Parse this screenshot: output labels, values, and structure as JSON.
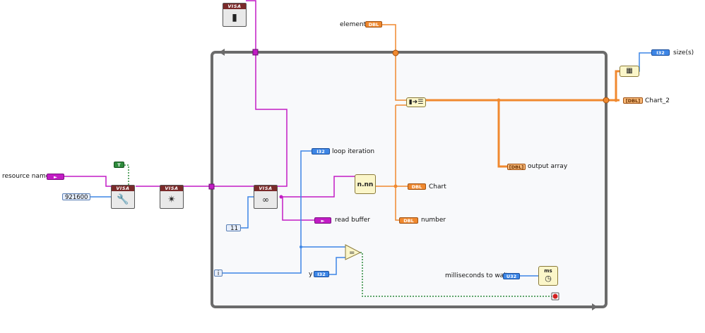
{
  "labels": {
    "resource_name": "resource name",
    "element": "element",
    "size": "size(s)",
    "chart2": "Chart_2",
    "loop_iteration": "loop iteration",
    "output_array": "output array",
    "chart": "Chart",
    "read_buffer": "read buffer",
    "number": "number",
    "y": "y",
    "ms_to_wait": "milliseconds to wait"
  },
  "terminals": {
    "dbl": "DBL",
    "i32": "I32",
    "u32": "U32",
    "arr_dbl": "[DBL]",
    "bool_true": "T"
  },
  "constants": {
    "baud": "921600",
    "byte_count": "11",
    "iteration": "i"
  },
  "nodes": {
    "visa_banner": "VISA",
    "format_value": "n.nn",
    "wait_ms": "ms"
  },
  "colors": {
    "wire_string": "#c21cc5",
    "wire_double": "#f0892f",
    "wire_integer": "#3d86e6",
    "wire_boolean": "#2e8b3c",
    "loop_border": "#6b6b6b",
    "stop_terminal": "#d22020"
  },
  "icons": {
    "close": "visa-close-icon",
    "configure": "visa-configure-icon",
    "flush": "visa-flush-icon",
    "read": "visa-read-icon",
    "build_array": "build-array-icon",
    "array_size": "array-size-icon",
    "wait": "wait-ms-icon",
    "equal": "equal-icon",
    "stop": "stop-terminal-icon"
  }
}
